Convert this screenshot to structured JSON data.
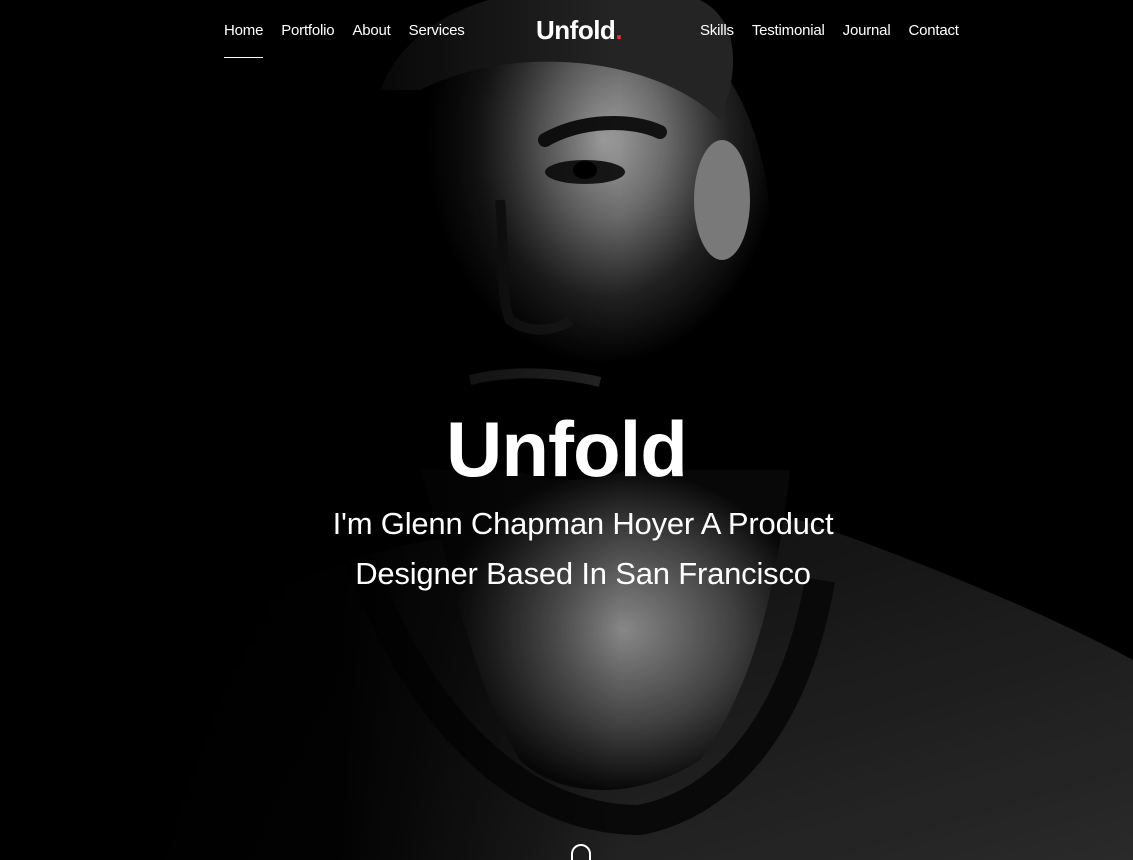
{
  "nav": {
    "left": [
      {
        "label": "Home",
        "active": true
      },
      {
        "label": "Portfolio"
      },
      {
        "label": "About"
      },
      {
        "label": "Services"
      }
    ],
    "right": [
      {
        "label": "Skills"
      },
      {
        "label": "Testimonial"
      },
      {
        "label": "Journal"
      },
      {
        "label": "Contact"
      }
    ]
  },
  "brand": {
    "name": "Unfold",
    "dot": "."
  },
  "hero": {
    "title": "Unfold",
    "subtitle": "I'm Glenn Chapman Hoyer A Product Designer Based In San Francisco"
  },
  "colors": {
    "accent": "#e32b3a",
    "background": "#000000",
    "text": "#ffffff"
  },
  "icons": {
    "scroll": "mouse-scroll-icon"
  }
}
